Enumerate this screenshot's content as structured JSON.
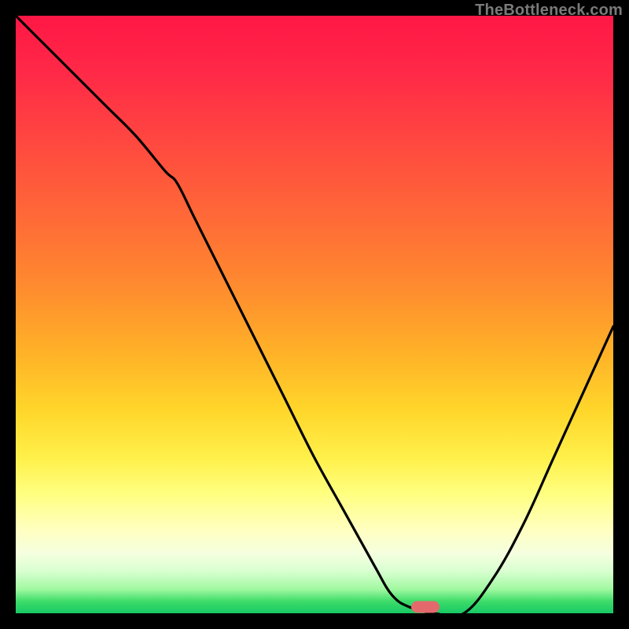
{
  "watermark": "TheBottleneck.com",
  "colors": {
    "frame": "#000000",
    "curve": "#000000",
    "marker": "#e4696d"
  },
  "chart_data": {
    "type": "line",
    "title": "",
    "xlabel": "",
    "ylabel": "",
    "xlim": [
      0,
      100
    ],
    "ylim": [
      0,
      100
    ],
    "x": [
      0,
      5,
      10,
      15,
      20,
      25,
      27,
      30,
      35,
      40,
      45,
      50,
      55,
      60,
      63,
      66,
      70,
      75,
      80,
      85,
      90,
      95,
      100
    ],
    "values": [
      100,
      95,
      90,
      85,
      80,
      74,
      72,
      66,
      56,
      46,
      36,
      26,
      17,
      8,
      3,
      1,
      0,
      0,
      6,
      15,
      26,
      37,
      48
    ],
    "marker": {
      "x_pct": 68.5,
      "y_from_top_pct": 99.0
    },
    "background_gradient_stops": [
      {
        "pct": 0,
        "color": "#ff1746"
      },
      {
        "pct": 10,
        "color": "#ff2a47"
      },
      {
        "pct": 22,
        "color": "#ff4a3f"
      },
      {
        "pct": 34,
        "color": "#ff6a37"
      },
      {
        "pct": 45,
        "color": "#ff8a2f"
      },
      {
        "pct": 56,
        "color": "#ffb028"
      },
      {
        "pct": 66,
        "color": "#ffd62a"
      },
      {
        "pct": 74,
        "color": "#fff04a"
      },
      {
        "pct": 80,
        "color": "#ffff80"
      },
      {
        "pct": 86,
        "color": "#ffffc0"
      },
      {
        "pct": 90,
        "color": "#f5ffe0"
      },
      {
        "pct": 93,
        "color": "#d8ffd0"
      },
      {
        "pct": 96,
        "color": "#a0f8a0"
      },
      {
        "pct": 98,
        "color": "#3ddc6a"
      },
      {
        "pct": 100,
        "color": "#17c964"
      }
    ]
  }
}
